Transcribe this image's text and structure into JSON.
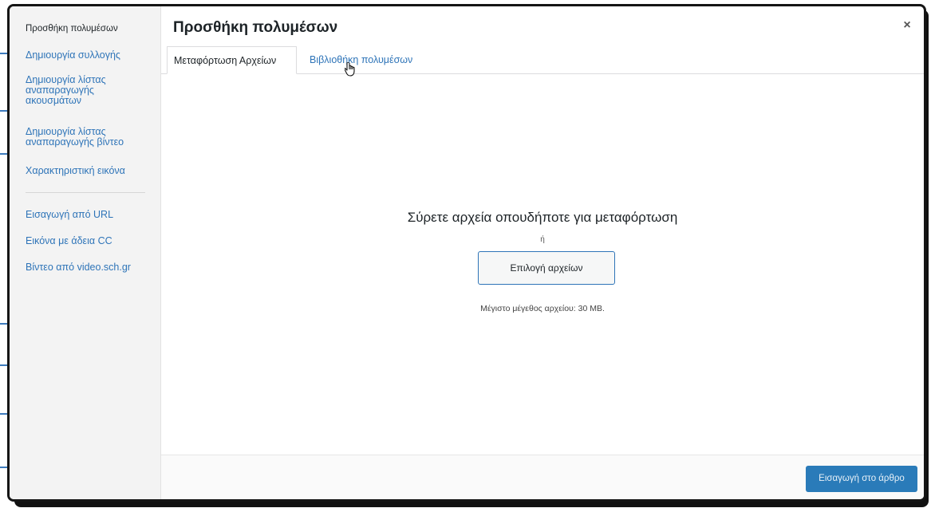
{
  "modal": {
    "title": "Προσθήκη πολυμέσων",
    "close_label": "×"
  },
  "sidebar": {
    "items": [
      {
        "label": "Προσθήκη πολυμέσων",
        "active": true
      },
      {
        "label": "Δημιουργία συλλογής"
      },
      {
        "label": "Δημιουργία λίστας αναπαραγωγής ακουσμάτων"
      },
      {
        "label": "Δημιουργία λίστας αναπαραγωγής βίντεο"
      },
      {
        "label": "Χαρακτηριστική εικόνα"
      },
      {
        "label": "Εισαγωγή από URL"
      },
      {
        "label": "Εικόνα με άδεια CC"
      },
      {
        "label": "Βίντεο από video.sch.gr"
      }
    ]
  },
  "tabs": [
    {
      "label": "Μεταφόρτωση Αρχείων",
      "active": true
    },
    {
      "label": "Βιβλιοθήκη πολυμέσων"
    }
  ],
  "upload": {
    "drop_title": "Σύρετε αρχεία οπουδήποτε για μεταφόρτωση",
    "or_text": "ή",
    "select_button": "Επιλογή αρχείων",
    "max_size": "Μέγιστο μέγεθος αρχείου: 30 MB."
  },
  "footer": {
    "insert_button": "Εισαγωγή στο άρθρο"
  },
  "colors": {
    "link": "#2e74b8",
    "primary_button": "#2a7bb9",
    "sidebar_bg": "#f3f3f3"
  },
  "icons": [
    "close-icon",
    "hand-cursor-icon"
  ]
}
